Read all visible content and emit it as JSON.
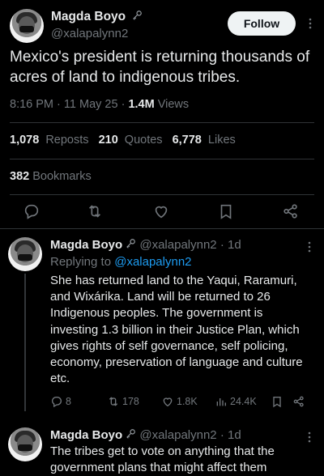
{
  "main_tweet": {
    "author_name": "Magda Boyo",
    "handle": "@xalapalynn2",
    "follow_label": "Follow",
    "text": "Mexico's president is returning thousands of acres of land to indigenous tribes.",
    "time": "8:16 PM",
    "date": "11 May 25",
    "sep": "·",
    "views_count": "1.4M",
    "views_label": "Views",
    "reposts_count": "1,078",
    "reposts_label": "Reposts",
    "quotes_count": "210",
    "quotes_label": "Quotes",
    "likes_count": "6,778",
    "likes_label": "Likes",
    "bookmarks_count": "382",
    "bookmarks_label": "Bookmarks"
  },
  "replies": [
    {
      "author_name": "Magda Boyo",
      "handle": "@xalapalynn2",
      "age": "1d",
      "sep": "·",
      "replying_prefix": "Replying to",
      "replying_to": "@xalapalynn2",
      "text": "She has returned land to the Yaqui, Raramuri, and Wixárika. Land will be returned to 26 Indigenous peoples. The government is investing 1.3 billion in their Justice Plan, which gives rights of self governance, self policing, economy, preservation of language and culture etc.",
      "replies_count": "8",
      "reposts_count": "178",
      "likes_count": "1.8K",
      "views_count": "24.4K"
    },
    {
      "author_name": "Magda Boyo",
      "handle": "@xalapalynn2",
      "age": "1d",
      "sep": "·",
      "text": "The tribes get to vote on anything that the government plans that might affect them"
    }
  ],
  "icons": {
    "badge": "key-icon",
    "more": "more-dots-icon",
    "reply": "reply-icon",
    "repost": "repost-icon",
    "like": "heart-icon",
    "bookmark": "bookmark-icon",
    "share": "share-icon",
    "views": "views-chart-icon"
  },
  "colors": {
    "background": "#000000",
    "text": "#e7e9ea",
    "muted": "#71767b",
    "link": "#1d9bf0",
    "divider": "#2f3336",
    "follow_button": "#eff3f4"
  }
}
